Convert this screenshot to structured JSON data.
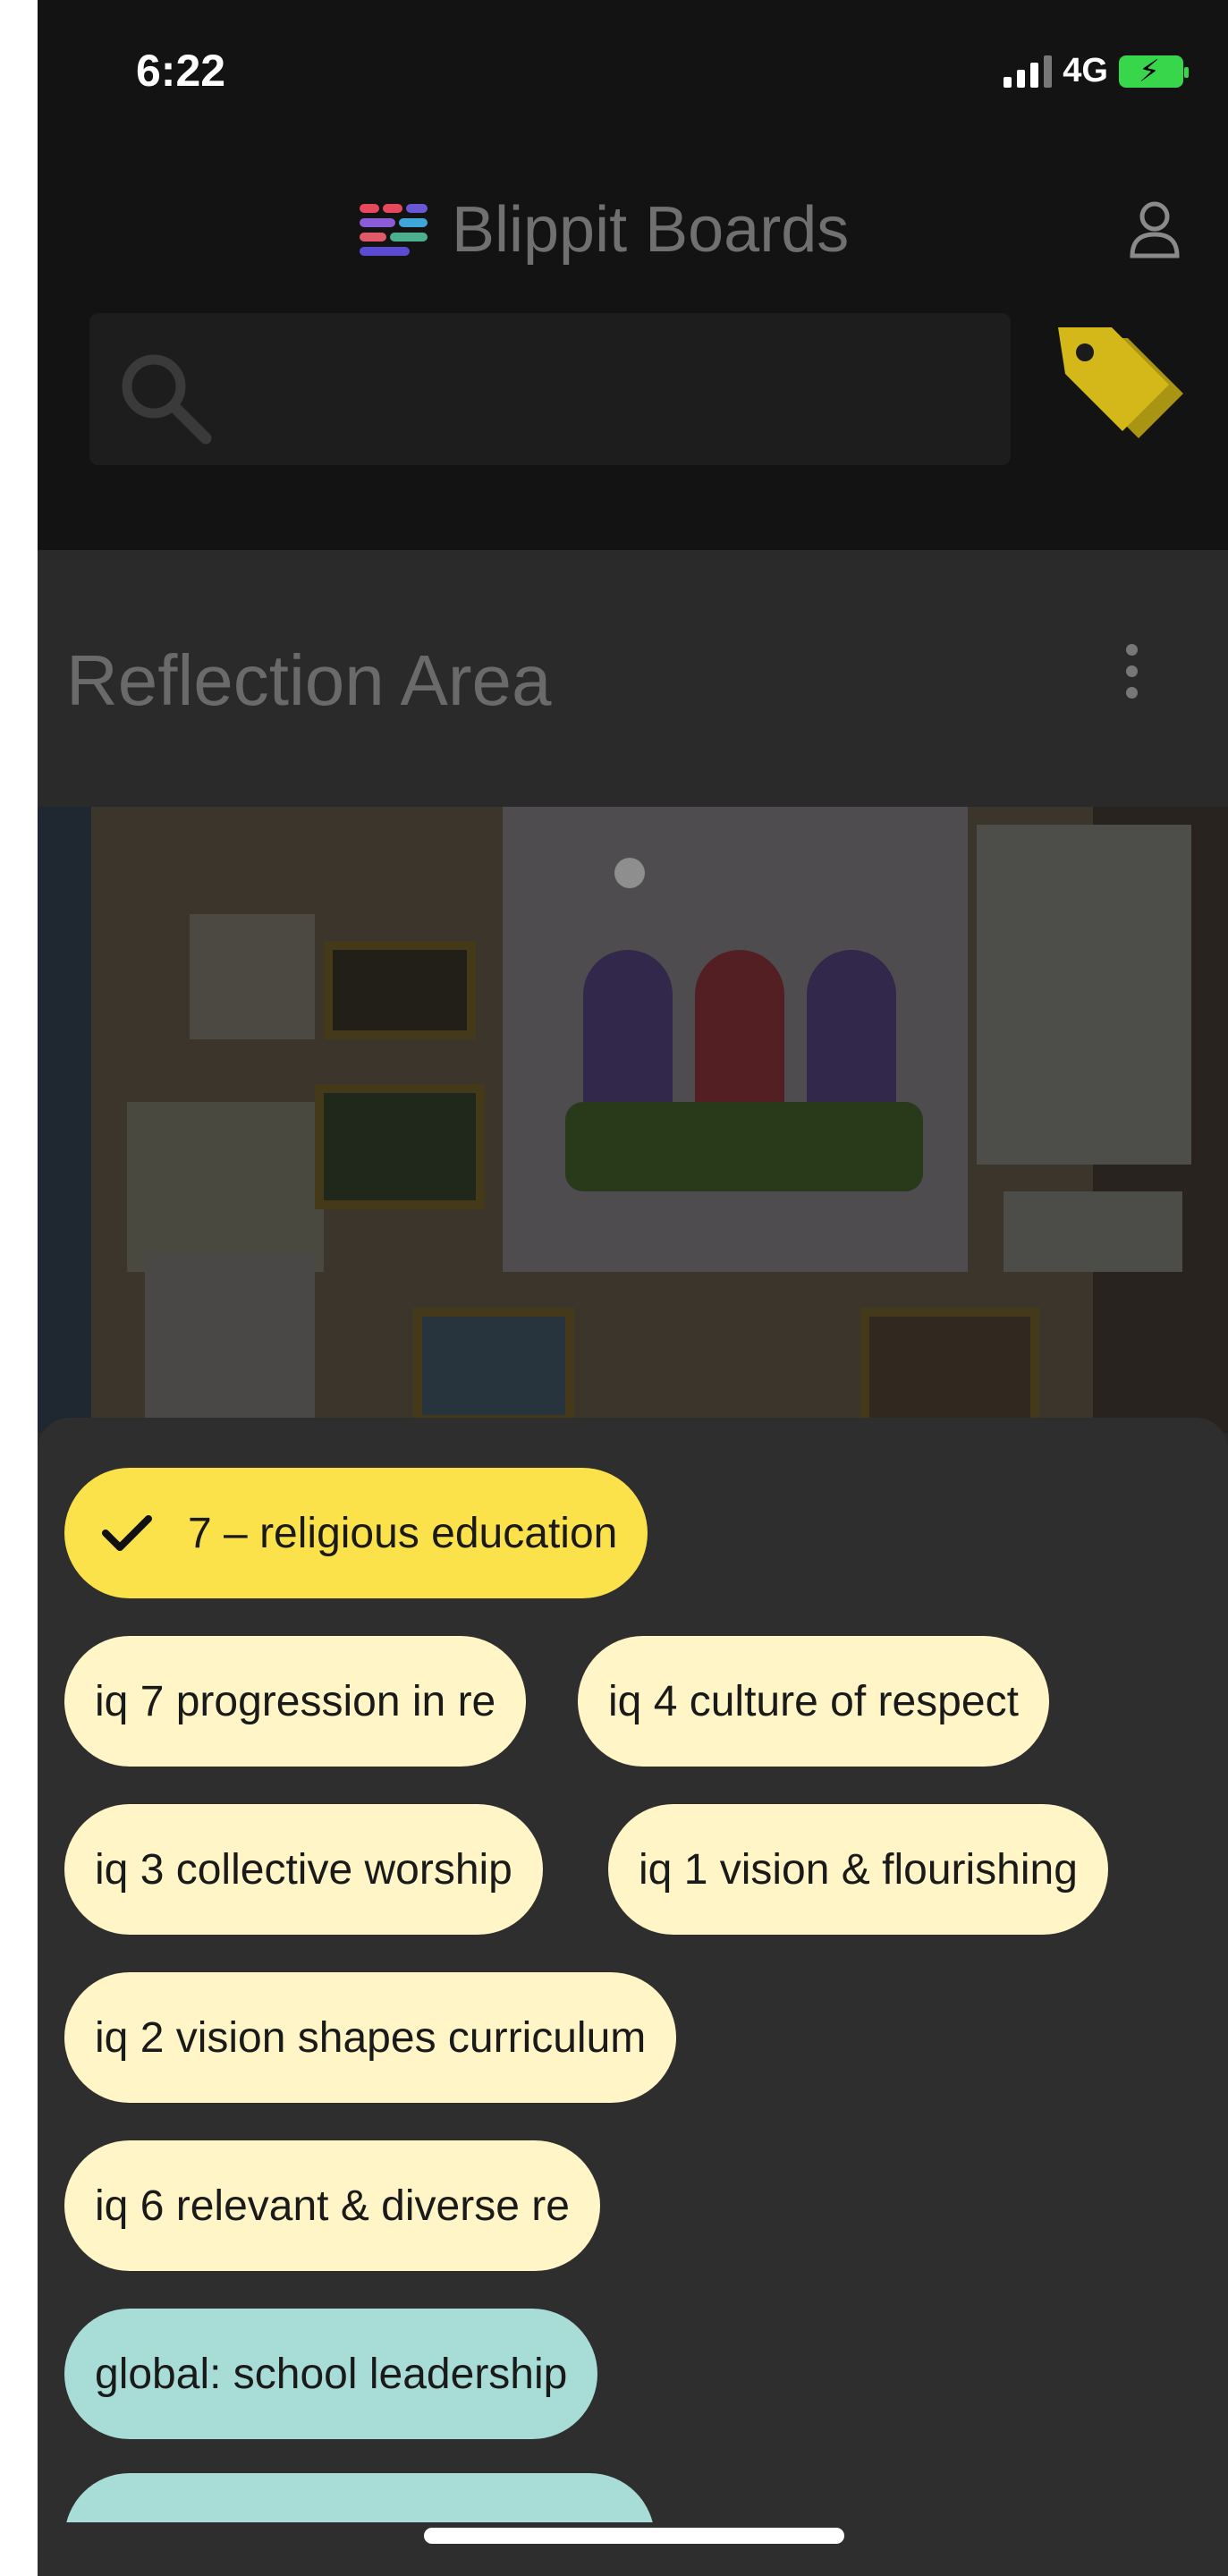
{
  "status_bar": {
    "time": "6:22",
    "network": "4G",
    "battery_icon": "battery-charging-icon",
    "battery_color": "#38d64b"
  },
  "header": {
    "app_title": "Blippit Boards",
    "logo_icon": "blippit-logo-icon",
    "profile_icon": "profile-icon",
    "search_placeholder": "",
    "tag_icon": "tag-filter-icon",
    "tag_color": "#d4b81a"
  },
  "card": {
    "title": "Reflection Area",
    "menu_icon": "more-vertical-icon",
    "photo_description_icon": "board-photo"
  },
  "tags": {
    "selected": {
      "label": "7 – religious education",
      "icon": "check-icon",
      "color": "#fce24a"
    },
    "items": [
      {
        "label": "iq 7 progression in re",
        "color": "#fff5c6"
      },
      {
        "label": "iq 4 culture of respect",
        "color": "#fff5c6"
      },
      {
        "label": "iq 3 collective worship",
        "color": "#fff5c6"
      },
      {
        "label": "iq 1 vision & flourishing",
        "color": "#fff5c6"
      },
      {
        "label": "iq 2 vision shapes curriculum",
        "color": "#fff5c6"
      },
      {
        "label": "iq 6 relevant & diverse re",
        "color": "#fff5c6"
      },
      {
        "label": "global: school leadership",
        "color": "#a8dcd6"
      }
    ]
  }
}
